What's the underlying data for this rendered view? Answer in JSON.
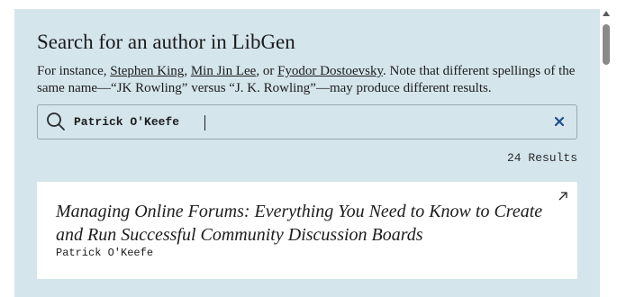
{
  "page": {
    "title": "Search for an author in LibGen",
    "description": {
      "prefix": "For instance, ",
      "examples": [
        "Stephen King",
        "Min Jin Lee",
        "Fyodor Dostoevsky"
      ],
      "sep1": ", ",
      "sep2": ", or ",
      "suffix": ". Note that different spellings of the same name—“JK Rowling” versus “J. K. Rowling”—may produce different results."
    }
  },
  "search": {
    "value": "Patrick O'Keefe",
    "icon": "search-icon",
    "clear_icon": "close-icon"
  },
  "results": {
    "count_label": "24 Results",
    "items": [
      {
        "title": "Managing Online Forums: Everything You Need to Know to Create and Run Successful Community Discussion Boards",
        "author": "Patrick O'Keefe",
        "icon": "external-link-icon"
      }
    ]
  },
  "colors": {
    "panel_bg": "#d4e5ec",
    "card_bg": "#ffffff",
    "text": "#1c1c1c",
    "accent": "#1f4e8c"
  }
}
